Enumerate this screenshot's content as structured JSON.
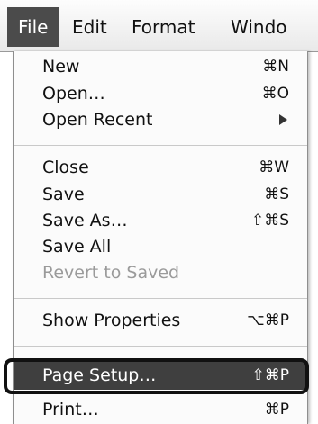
{
  "menubar": {
    "file": "File",
    "edit": "Edit",
    "format": "Format",
    "window": "Windo"
  },
  "menu": {
    "new": {
      "label": "New",
      "shortcut": "⌘N"
    },
    "open": {
      "label": "Open…",
      "shortcut": "⌘O"
    },
    "open_recent": {
      "label": "Open Recent",
      "submenu_icon": "submenu-arrow-icon"
    },
    "close": {
      "label": "Close",
      "shortcut": "⌘W"
    },
    "save": {
      "label": "Save",
      "shortcut": "⌘S"
    },
    "save_as": {
      "label": "Save As…",
      "shortcut": "⇧⌘S"
    },
    "save_all": {
      "label": "Save All"
    },
    "revert": {
      "label": "Revert to Saved"
    },
    "show_properties": {
      "label": "Show Properties",
      "shortcut": "⌥⌘P"
    },
    "page_setup": {
      "label": "Page Setup…",
      "shortcut": "⇧⌘P"
    },
    "print": {
      "label": "Print…",
      "shortcut": "⌘P"
    }
  },
  "colors": {
    "highlight": "#3f3f3f",
    "disabled_text": "#9a9a9a"
  }
}
